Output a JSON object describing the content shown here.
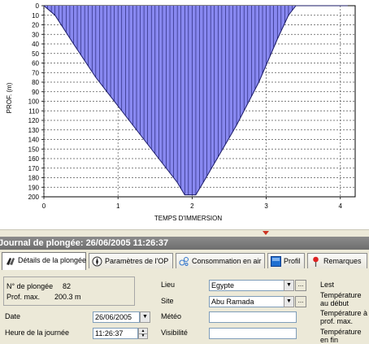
{
  "chart_data": {
    "type": "area",
    "title": "",
    "xlabel": "TEMPS D'IMMERSION",
    "ylabel": "PROF. (m)",
    "xlim": [
      0,
      4.2
    ],
    "ylim": [
      0,
      200
    ],
    "y_inverted": true,
    "x_ticks": [
      "0",
      "1",
      "2",
      "3",
      "4"
    ],
    "y_ticks": [
      "0",
      "10",
      "20",
      "30",
      "40",
      "50",
      "60",
      "70",
      "80",
      "90",
      "100",
      "110",
      "120",
      "130",
      "140",
      "150",
      "160",
      "170",
      "180",
      "190",
      "200"
    ],
    "grid": true,
    "fill_color": "#8888f0",
    "series": [
      {
        "x": [
          0,
          0.15,
          0.4,
          0.7,
          1.0,
          1.3,
          1.6,
          1.8,
          1.9,
          2.05,
          2.15,
          2.3,
          2.6,
          2.9,
          3.15,
          3.3,
          3.4,
          4.1
        ],
        "values": [
          0,
          10,
          40,
          75,
          105,
          135,
          165,
          185,
          198,
          198,
          185,
          165,
          125,
          80,
          35,
          10,
          0,
          0
        ]
      }
    ]
  },
  "splitter": {
    "arrow_color": "#cc3322"
  },
  "window": {
    "title": "Journal de plongée: 26/06/2005 11:26:37"
  },
  "tabs": [
    {
      "label": "Détails de la plongée",
      "icon": "fins-icon",
      "active": true
    },
    {
      "label": "Paramètres de l'OP",
      "icon": "compass-icon",
      "active": false
    },
    {
      "label": "Consommation en air",
      "icon": "bubbles-icon",
      "active": false
    },
    {
      "label": "Profil",
      "icon": "profile-icon",
      "active": false
    },
    {
      "label": "Remarques",
      "icon": "pin-icon",
      "active": false
    }
  ],
  "details": {
    "dive_number_label": "N° de plongée",
    "dive_number_value": "82",
    "max_depth_label": "Prof. max.",
    "max_depth_value": "200.3 m",
    "date_label": "Date",
    "date_value": "26/06/2005",
    "time_label": "Heure de la journée",
    "time_value": "11:26:37",
    "location_label": "Lieu",
    "location_value": "Egypte",
    "site_label": "Site",
    "site_value": "Abu Ramada",
    "weather_label": "Météo",
    "weather_value": "",
    "visibility_label": "Visibilité",
    "visibility_value": "",
    "lest_label": "Lest",
    "temp_start_label": "Température au début",
    "temp_max_label": "Température à prof. max.",
    "temp_end_label": "Température en fin",
    "dots_label": "..."
  }
}
